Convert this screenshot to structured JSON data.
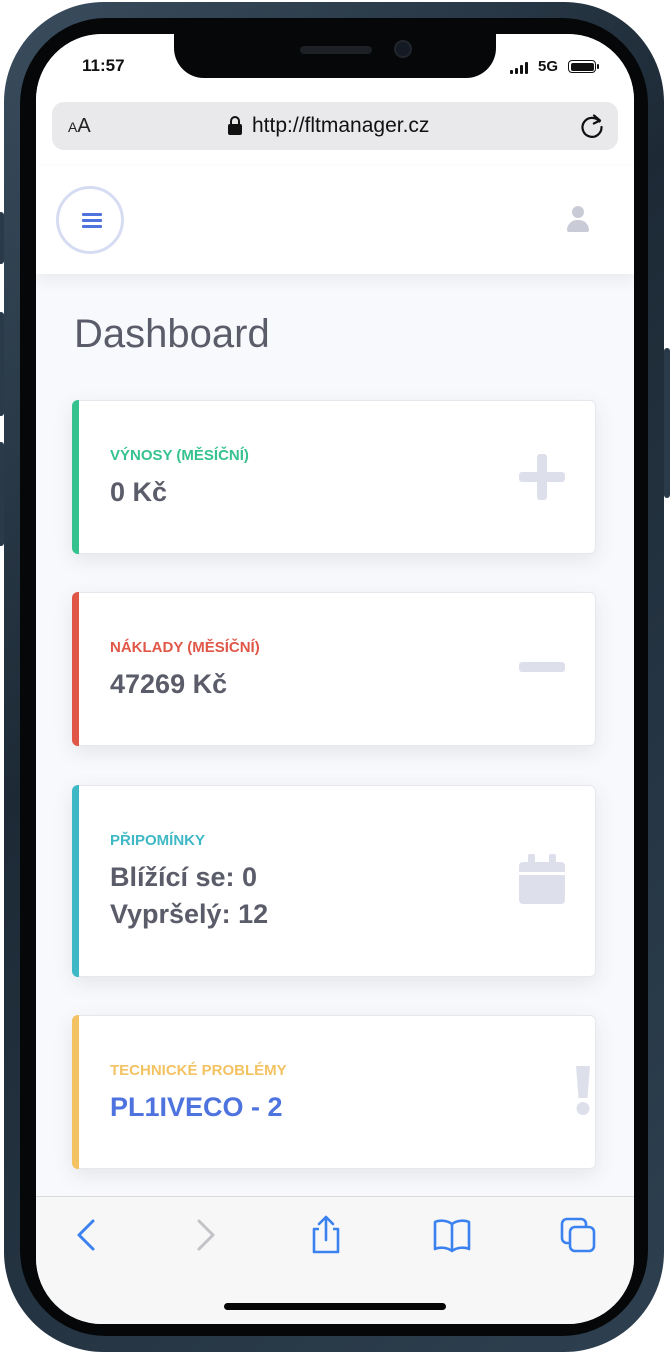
{
  "status_bar": {
    "time": "11:57",
    "network": "5G"
  },
  "browser": {
    "text_size_label": "AA",
    "url": "http://fltmanager.cz"
  },
  "page": {
    "title": "Dashboard",
    "cards": [
      {
        "label": "Výnosy (Měsíční)",
        "lines": [
          "0 Kč"
        ],
        "accent": "#36c28e",
        "icon": "plus-icon"
      },
      {
        "label": "Náklady (Měsíční)",
        "lines": [
          "47269 Kč"
        ],
        "accent": "#e05748",
        "icon": "minus-icon"
      },
      {
        "label": "Připomínky",
        "lines": [
          "Blížící se: 0",
          "Vypršelý: 12"
        ],
        "accent": "#3fb8c6",
        "icon": "calendar-icon"
      },
      {
        "label": "Technické problémy",
        "lines": [
          "PL1IVECO - 2"
        ],
        "accent": "#f3c262",
        "icon": "exclamation-icon"
      }
    ]
  },
  "colors": {
    "primary": "#4e73df",
    "text_gray": "#5a5c69",
    "icon_gray": "#dddfeb"
  }
}
